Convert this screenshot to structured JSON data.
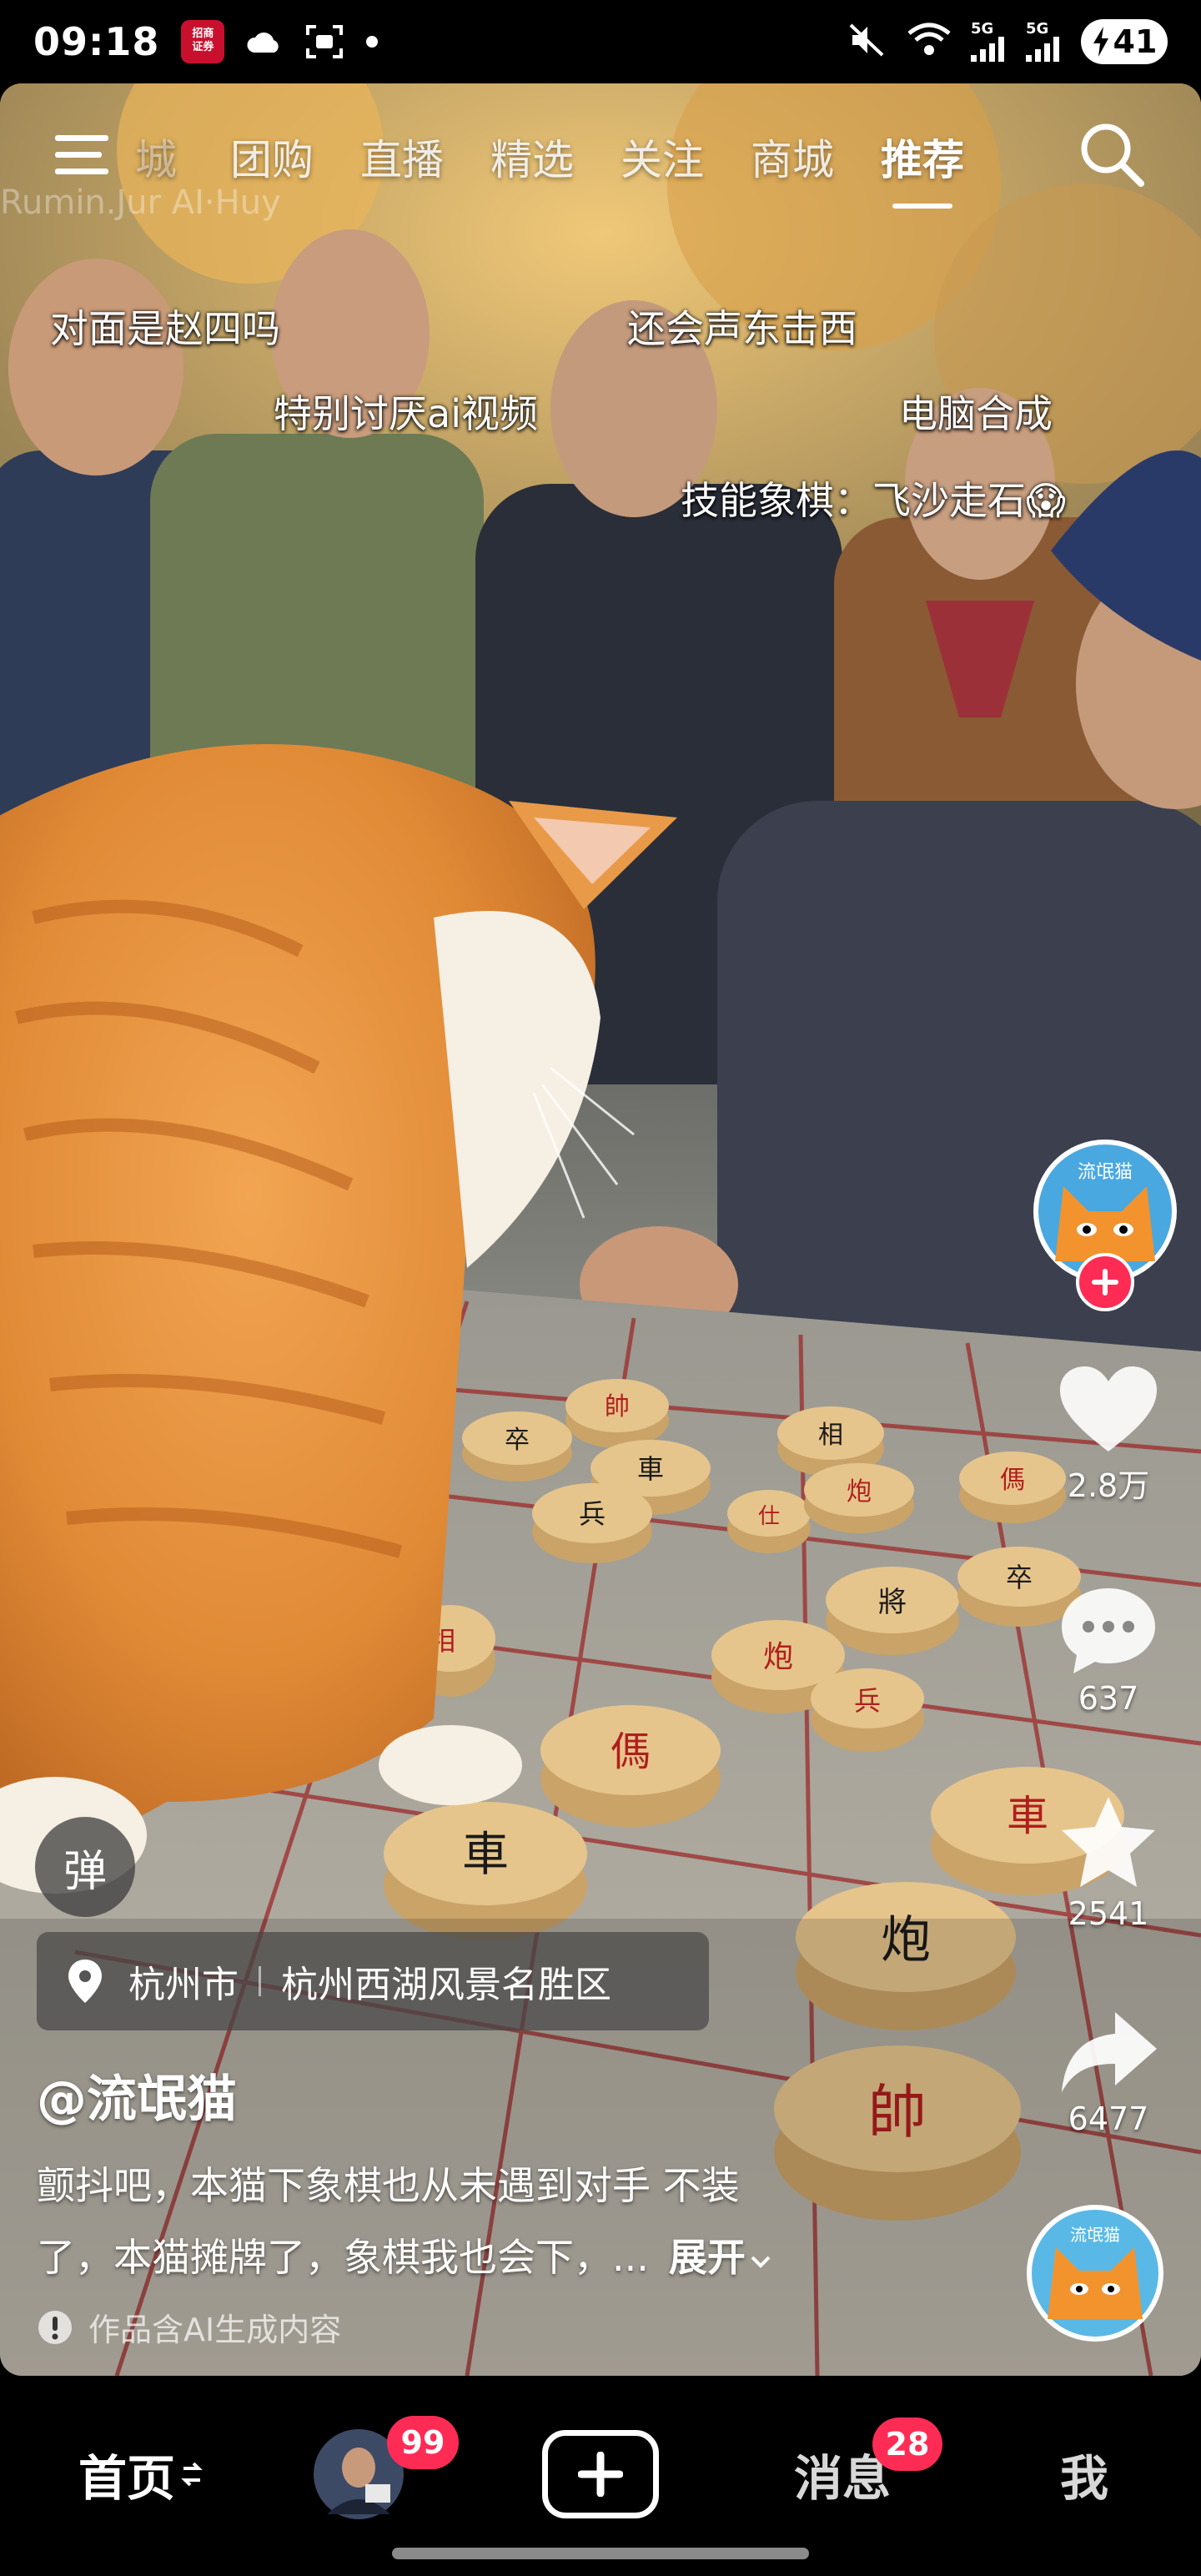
{
  "status_bar": {
    "time": "09:18",
    "app_badge": "招商\n证券",
    "battery": "41",
    "net1": "5G",
    "net2": "5G"
  },
  "top_nav": {
    "watermark": "Rumin.Jur AI·Huy",
    "partial_tab": "城",
    "tabs": [
      "团购",
      "直播",
      "精选",
      "关注",
      "商城",
      "推荐"
    ],
    "active_tab": "推荐"
  },
  "danmaku": [
    "对面是赵四吗",
    "还会声东击西",
    "特别讨厌ai视频",
    "电脑合成",
    "技能象棋：飞沙走石😱"
  ],
  "rail": {
    "avatar_label": "流氓猫",
    "likes": "2.8万",
    "comments": "637",
    "favorites": "2541",
    "shares": "6477",
    "music_label": "流氓猫"
  },
  "info": {
    "danmu_toggle": "弹",
    "location_city": "杭州市",
    "location_place": "杭州西湖风景名胜区",
    "author": "@流氓猫",
    "desc_line1": "颤抖吧，本猫下象棋也从未遇到对手 不装",
    "desc_line2": "了，本猫摊牌了，象棋我也会下，...",
    "expand_label": "展开",
    "ai_note": "作品含AI生成内容"
  },
  "tabbar": {
    "home": "首页",
    "friends_badge": "99",
    "messages": "消息",
    "messages_badge": "28",
    "me": "我"
  },
  "board_pieces": [
    "帥",
    "卒",
    "車",
    "相",
    "兵",
    "仕",
    "炮",
    "傌",
    "將"
  ],
  "colors": {
    "accent_red": "#fe2c55",
    "piece_wood": "#e2bf84",
    "piece_black_char": "#1a1a1a",
    "piece_red_char": "#b01e1e"
  }
}
